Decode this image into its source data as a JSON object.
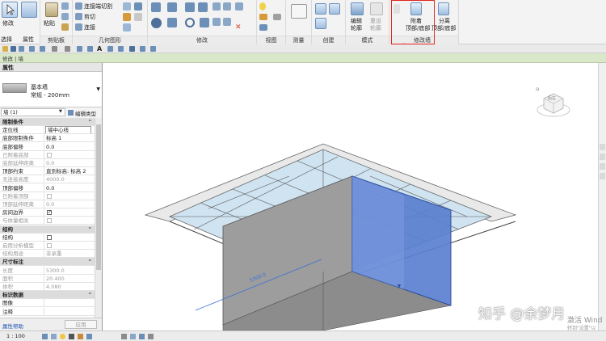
{
  "ribbon": {
    "select_label": "选择",
    "properties_label": "属性",
    "modify_label": "修改",
    "clipboard_label": "剪贴板",
    "paste_label": "粘贴",
    "geometry_label": "几何图形",
    "geometry_items": [
      "连接端切割",
      "剪切",
      "连接"
    ],
    "modify_panel_label": "修改",
    "view_label": "视图",
    "measure_label": "测量",
    "create_label": "创建",
    "mode_label": "模式",
    "edit_profile_label_1": "编辑",
    "edit_profile_label_2": "轮廓",
    "reset_profile_label_1": "重设",
    "reset_profile_label_2": "轮廓",
    "attach_label_1": "附着",
    "attach_label_2": "顶部/底部",
    "detach_label_1": "分离",
    "detach_label_2": "顶部/底部",
    "modify_wall_label": "修改墙"
  },
  "optbar": {
    "context_label": "修改 | 墙"
  },
  "properties": {
    "header": "属性",
    "family_name": "基本墙",
    "type_name": "常规 - 200mm",
    "instance_selector": "墙 (1)",
    "edit_type_label": "编辑类型",
    "rows": [
      {
        "kind": "cat",
        "key": "限制条件"
      },
      {
        "kind": "val",
        "key": "定位线",
        "value": "墙中心线",
        "boxed": true
      },
      {
        "kind": "val",
        "key": "底部限制条件",
        "value": "标高 1"
      },
      {
        "kind": "val",
        "key": "底部偏移",
        "value": "0.0"
      },
      {
        "kind": "chk",
        "key": "已附着底部",
        "checked": false,
        "muted": true
      },
      {
        "kind": "val",
        "key": "底部延伸距离",
        "value": "0.0",
        "muted": true
      },
      {
        "kind": "val",
        "key": "顶部约束",
        "value": "直到标高: 标高 2"
      },
      {
        "kind": "val",
        "key": "无连接高度",
        "value": "4000.0",
        "muted": true
      },
      {
        "kind": "val",
        "key": "顶部偏移",
        "value": "0.0"
      },
      {
        "kind": "chk",
        "key": "已附着顶部",
        "checked": false,
        "muted": true
      },
      {
        "kind": "val",
        "key": "顶部延伸距离",
        "value": "0.0",
        "muted": true
      },
      {
        "kind": "chk",
        "key": "房间边界",
        "checked": true
      },
      {
        "kind": "chk",
        "key": "与体量相关",
        "checked": false,
        "muted": true
      },
      {
        "kind": "cat",
        "key": "结构"
      },
      {
        "kind": "chk",
        "key": "结构",
        "checked": false
      },
      {
        "kind": "chk",
        "key": "启用分析模型",
        "checked": false,
        "muted": true
      },
      {
        "kind": "val",
        "key": "结构用途",
        "value": "非承重",
        "muted": true
      },
      {
        "kind": "cat",
        "key": "尺寸标注"
      },
      {
        "kind": "val",
        "key": "长度",
        "value": "5300.0",
        "muted": true
      },
      {
        "kind": "val",
        "key": "面积",
        "value": "20.400",
        "muted": true
      },
      {
        "kind": "val",
        "key": "体积",
        "value": "4.080",
        "muted": true
      },
      {
        "kind": "cat",
        "key": "标识数据"
      },
      {
        "kind": "val",
        "key": "图像",
        "value": ""
      },
      {
        "kind": "val",
        "key": "注释",
        "value": ""
      }
    ],
    "help_link": "属性帮助",
    "apply_button": "应用"
  },
  "status": {
    "scale": "1 : 100"
  },
  "viewport": {
    "dimension_value": "5300.0",
    "viewcube_label": "后左"
  },
  "watermark": {
    "text": "知乎 @余梦月",
    "activate_line1": "激活 Wind",
    "activate_line2": "转到\"设置\"以"
  },
  "colors": {
    "highlight": "#e0251b",
    "selected_wall": "#5b7fcf",
    "options_bar": "#d8e8c8"
  }
}
